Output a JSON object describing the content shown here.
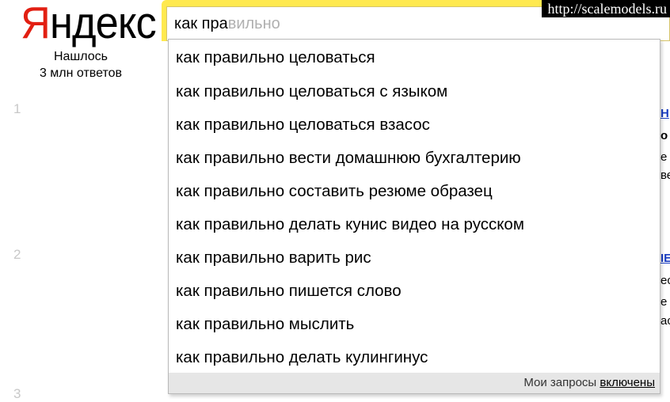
{
  "logo": {
    "first_letter": "Я",
    "rest": "ндекс"
  },
  "results_info": {
    "line1": "Нашлось",
    "line2": "3 млн ответов"
  },
  "result_numbers": [
    "1",
    "2",
    "3"
  ],
  "search": {
    "typed": "как пра",
    "hint": "вильно"
  },
  "watermark": "http://scalemodels.ru",
  "suggestions": [
    "как правильно целоваться",
    "как правильно целоваться с языком",
    "как правильно целоваться взасос",
    "как правильно вести домашнюю бухгалтерию",
    "как правильно составить резюме образец",
    "как правильно делать кунис видео на русском",
    "как правильно варить рис",
    "как правильно пишется слово",
    "как правильно мыслить",
    "как правильно делать кулингинус"
  ],
  "suggest_footer": {
    "label": "Мои запросы",
    "toggle": "включены"
  },
  "edge_fragments": [
    "Н",
    "о",
    "е",
    "ве",
    "IE",
    "ес",
    "е",
    "ас"
  ],
  "colors": {
    "logo_red": "#e21f12",
    "search_band": "#ffe94f",
    "footer_bg": "#e6e6e6"
  }
}
